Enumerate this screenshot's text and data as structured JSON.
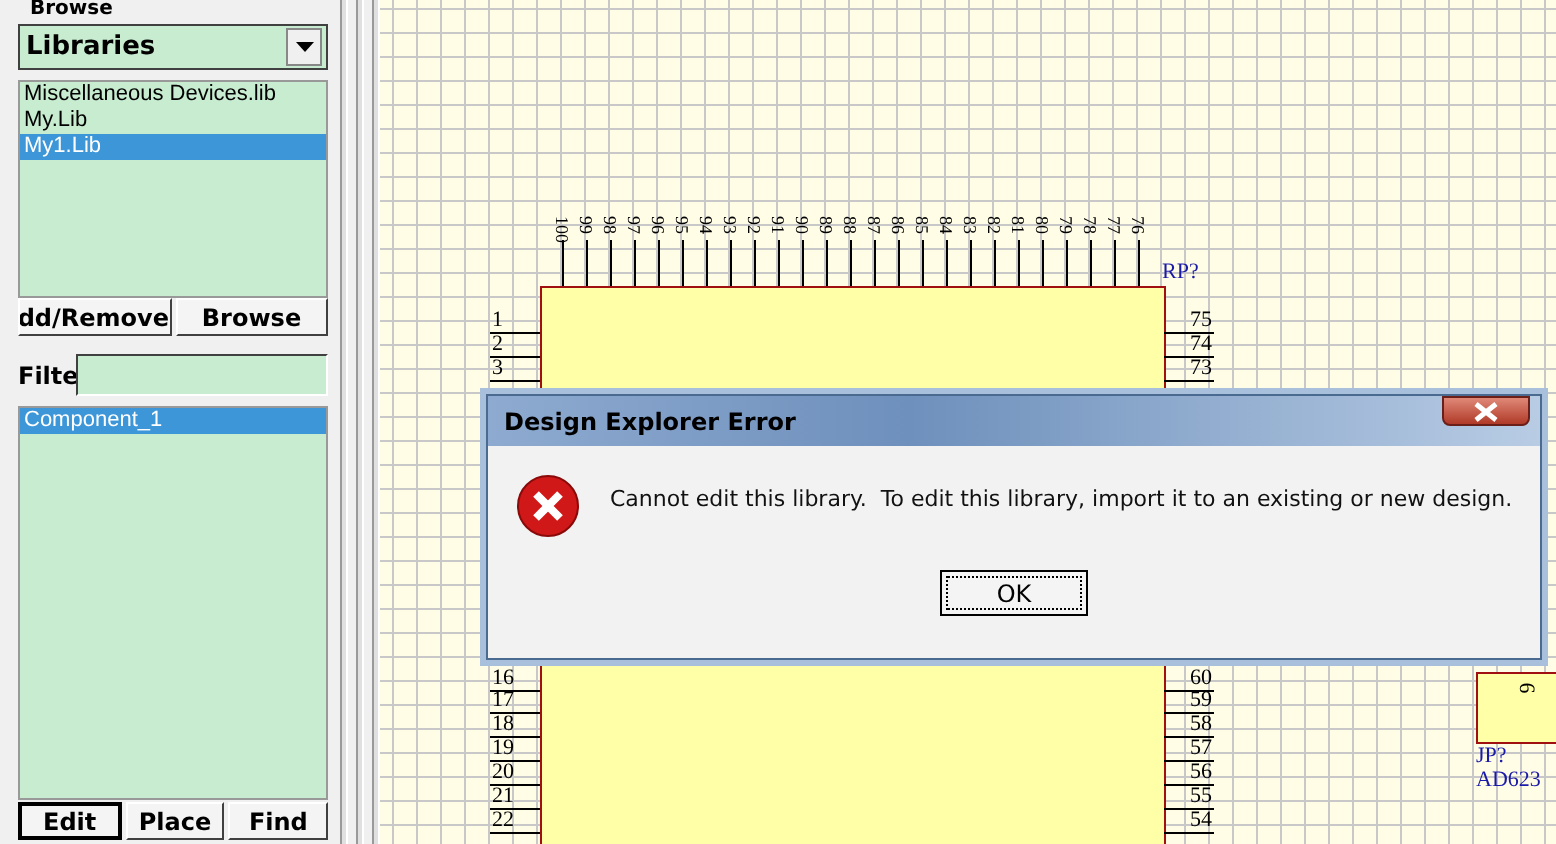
{
  "panel": {
    "title": "Browse",
    "dropdown": "Libraries",
    "libraries": [
      {
        "label": "Miscellaneous Devices.lib",
        "selected": false
      },
      {
        "label": "My.Lib",
        "selected": false
      },
      {
        "label": "My1.Lib",
        "selected": true
      }
    ],
    "library_buttons": [
      "dd/Remove",
      "Browse"
    ],
    "filter": {
      "label": "Filte"
    },
    "components": [
      {
        "label": "Component_1",
        "selected": true
      }
    ],
    "component_buttons": [
      {
        "label": "Edit",
        "focused": true
      },
      {
        "label": "Place",
        "focused": false
      },
      {
        "label": "Find",
        "focused": false
      }
    ]
  },
  "schematic": {
    "chip": {
      "designator": "RP?",
      "top_pins": [
        "100",
        "99",
        "98",
        "97",
        "96",
        "95",
        "94",
        "93",
        "92",
        "91",
        "90",
        "89",
        "88",
        "87",
        "86",
        "85",
        "84",
        "83",
        "82",
        "81",
        "80",
        "79",
        "78",
        "77",
        "76"
      ],
      "left_pins_upper": [
        "1",
        "2",
        "3"
      ],
      "left_pins_lower": [
        "16",
        "17",
        "18",
        "19",
        "20",
        "21",
        "22"
      ],
      "right_pins_upper": [
        "75",
        "74",
        "73"
      ],
      "right_pins_lower": [
        "60",
        "59",
        "58",
        "57",
        "56",
        "55",
        "54"
      ]
    },
    "part": {
      "pin": "6",
      "designator": "JP?",
      "value": "AD623"
    }
  },
  "dialog": {
    "title": "Design Explorer Error",
    "message": "Cannot edit this library.  To edit this library, import it to an existing or new design.",
    "button": "OK"
  }
}
